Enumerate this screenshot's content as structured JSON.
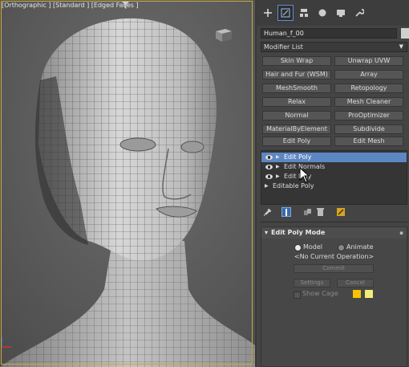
{
  "viewport": {
    "label": "[Orthographic ] [Standard ] [Edged Faces ]",
    "filter_icon": "funnel-icon",
    "nav_cube_icon": "viewcube-icon",
    "axis_icon": "axis-gizmo-icon"
  },
  "command_panel": {
    "tabs": [
      {
        "name": "create",
        "icon": "plus-icon",
        "active": false
      },
      {
        "name": "modify",
        "icon": "modify-icon",
        "active": true
      },
      {
        "name": "hierarchy",
        "icon": "hierarchy-icon",
        "active": false
      },
      {
        "name": "motion",
        "icon": "motion-icon",
        "active": false
      },
      {
        "name": "display",
        "icon": "display-icon",
        "active": false
      },
      {
        "name": "utilities",
        "icon": "wrench-icon",
        "active": false
      }
    ],
    "object_name": "Human_f_00",
    "object_color": "#d0d0d0",
    "modifier_list_label": "Modifier List",
    "modifier_buttons": [
      "Skin Wrap",
      "Unwrap UVW",
      "Hair and Fur (WSM)",
      "Array",
      "MeshSmooth",
      "Retopology",
      "Relax",
      "Mesh Cleaner",
      "Normal",
      "ProOptimizer",
      "MaterialByElement",
      "Subdivide",
      "Edit Poly",
      "Edit Mesh"
    ],
    "stack": [
      {
        "label": "Edit Poly",
        "selected": true,
        "eye": true
      },
      {
        "label": "Edit Normals",
        "selected": false,
        "eye": true
      },
      {
        "label": "Edit Poly",
        "selected": false,
        "eye": true
      },
      {
        "label": "Editable Poly",
        "selected": false,
        "eye": false
      }
    ],
    "stack_tools": [
      "pin-icon",
      "show-end-result-icon",
      "make-unique-icon",
      "remove-modifier-icon",
      "configure-sets-icon"
    ],
    "rollout": {
      "title": "Edit Poly Mode",
      "mode_model": "Model",
      "mode_animate": "Animate",
      "current_operation": "<No Current Operation>",
      "commit_label": "Commit",
      "settings_label": "Settings",
      "cancel_label": "Cancel",
      "show_cage_label": "Show Cage",
      "cage_color_1": "#f5c400",
      "cage_color_2": "#f3ec7a"
    },
    "accent_color": "#5d87c2"
  }
}
